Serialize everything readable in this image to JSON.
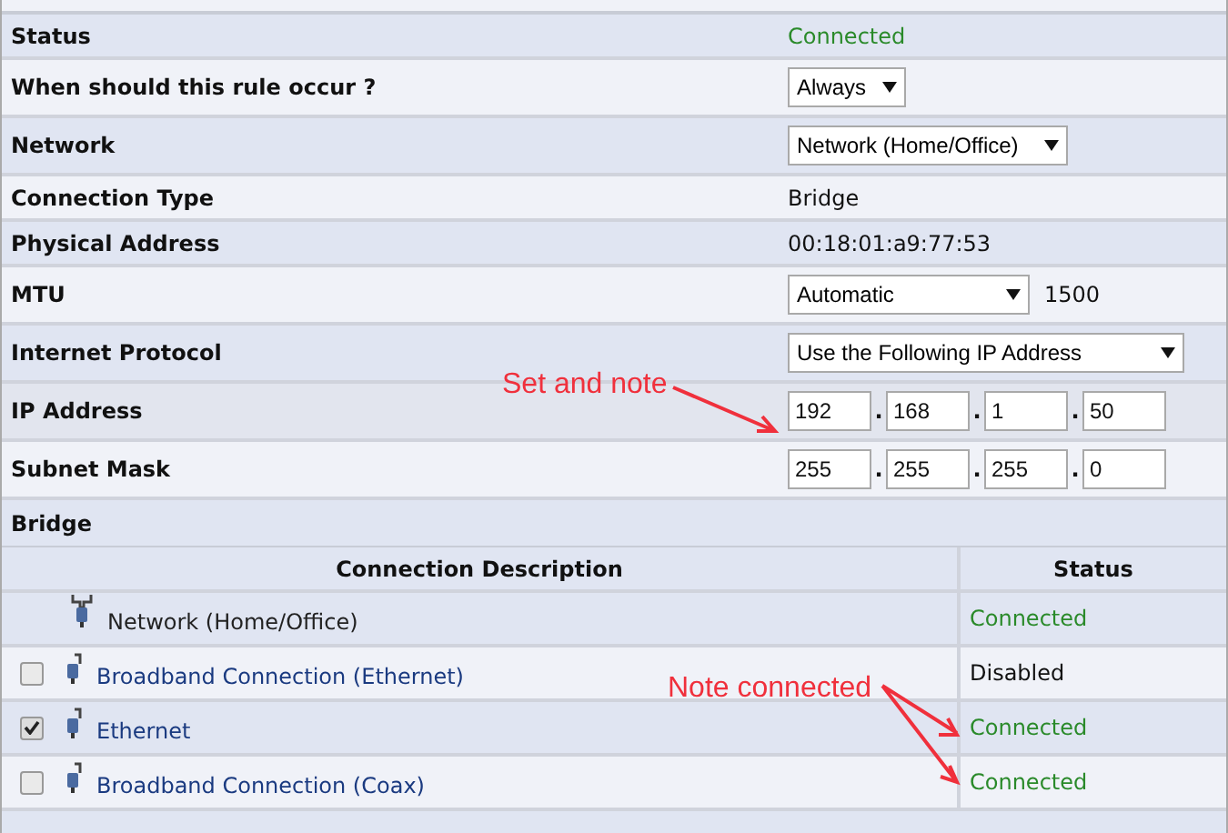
{
  "settings": [
    {
      "label": "Status",
      "kind": "status",
      "value": "Connected"
    },
    {
      "label": "When should this rule occur ?",
      "kind": "select",
      "value": "Always"
    },
    {
      "label": "Network",
      "kind": "select",
      "value": "Network (Home/Office)"
    },
    {
      "label": "Connection Type",
      "kind": "text",
      "value": "Bridge"
    },
    {
      "label": "Physical Address",
      "kind": "text",
      "value": "00:18:01:a9:77:53"
    },
    {
      "label": "MTU",
      "kind": "select",
      "value": "Automatic",
      "extra": "1500"
    },
    {
      "label": "Internet Protocol",
      "kind": "select",
      "value": "Use the Following IP Address"
    },
    {
      "label": "IP Address",
      "kind": "ip",
      "octets": [
        "192",
        "168",
        "1",
        "50"
      ],
      "separators": [
        ".",
        ".",
        "."
      ]
    },
    {
      "label": "Subnet Mask",
      "kind": "ip",
      "octets": [
        "255",
        "255",
        "255",
        "0"
      ],
      "separators": [
        ".",
        ".",
        "."
      ]
    }
  ],
  "bridge": {
    "title": "Bridge",
    "columns": [
      "Connection Description",
      "Status"
    ],
    "rows": [
      {
        "kind": "network",
        "name": "Network (Home/Office)",
        "status": "Connected",
        "connected": true
      },
      {
        "kind": "member",
        "checked": false,
        "name": "Broadband Connection (Ethernet)",
        "status": "Disabled",
        "connected": false
      },
      {
        "kind": "member",
        "checked": true,
        "name": "Ethernet",
        "status": "Connected",
        "connected": true
      },
      {
        "kind": "member",
        "checked": false,
        "name": "Broadband Connection (Coax)",
        "status": "Connected",
        "connected": true
      }
    ]
  },
  "annotations": [
    {
      "text": "Set and note"
    },
    {
      "text": "Note connected"
    }
  ]
}
